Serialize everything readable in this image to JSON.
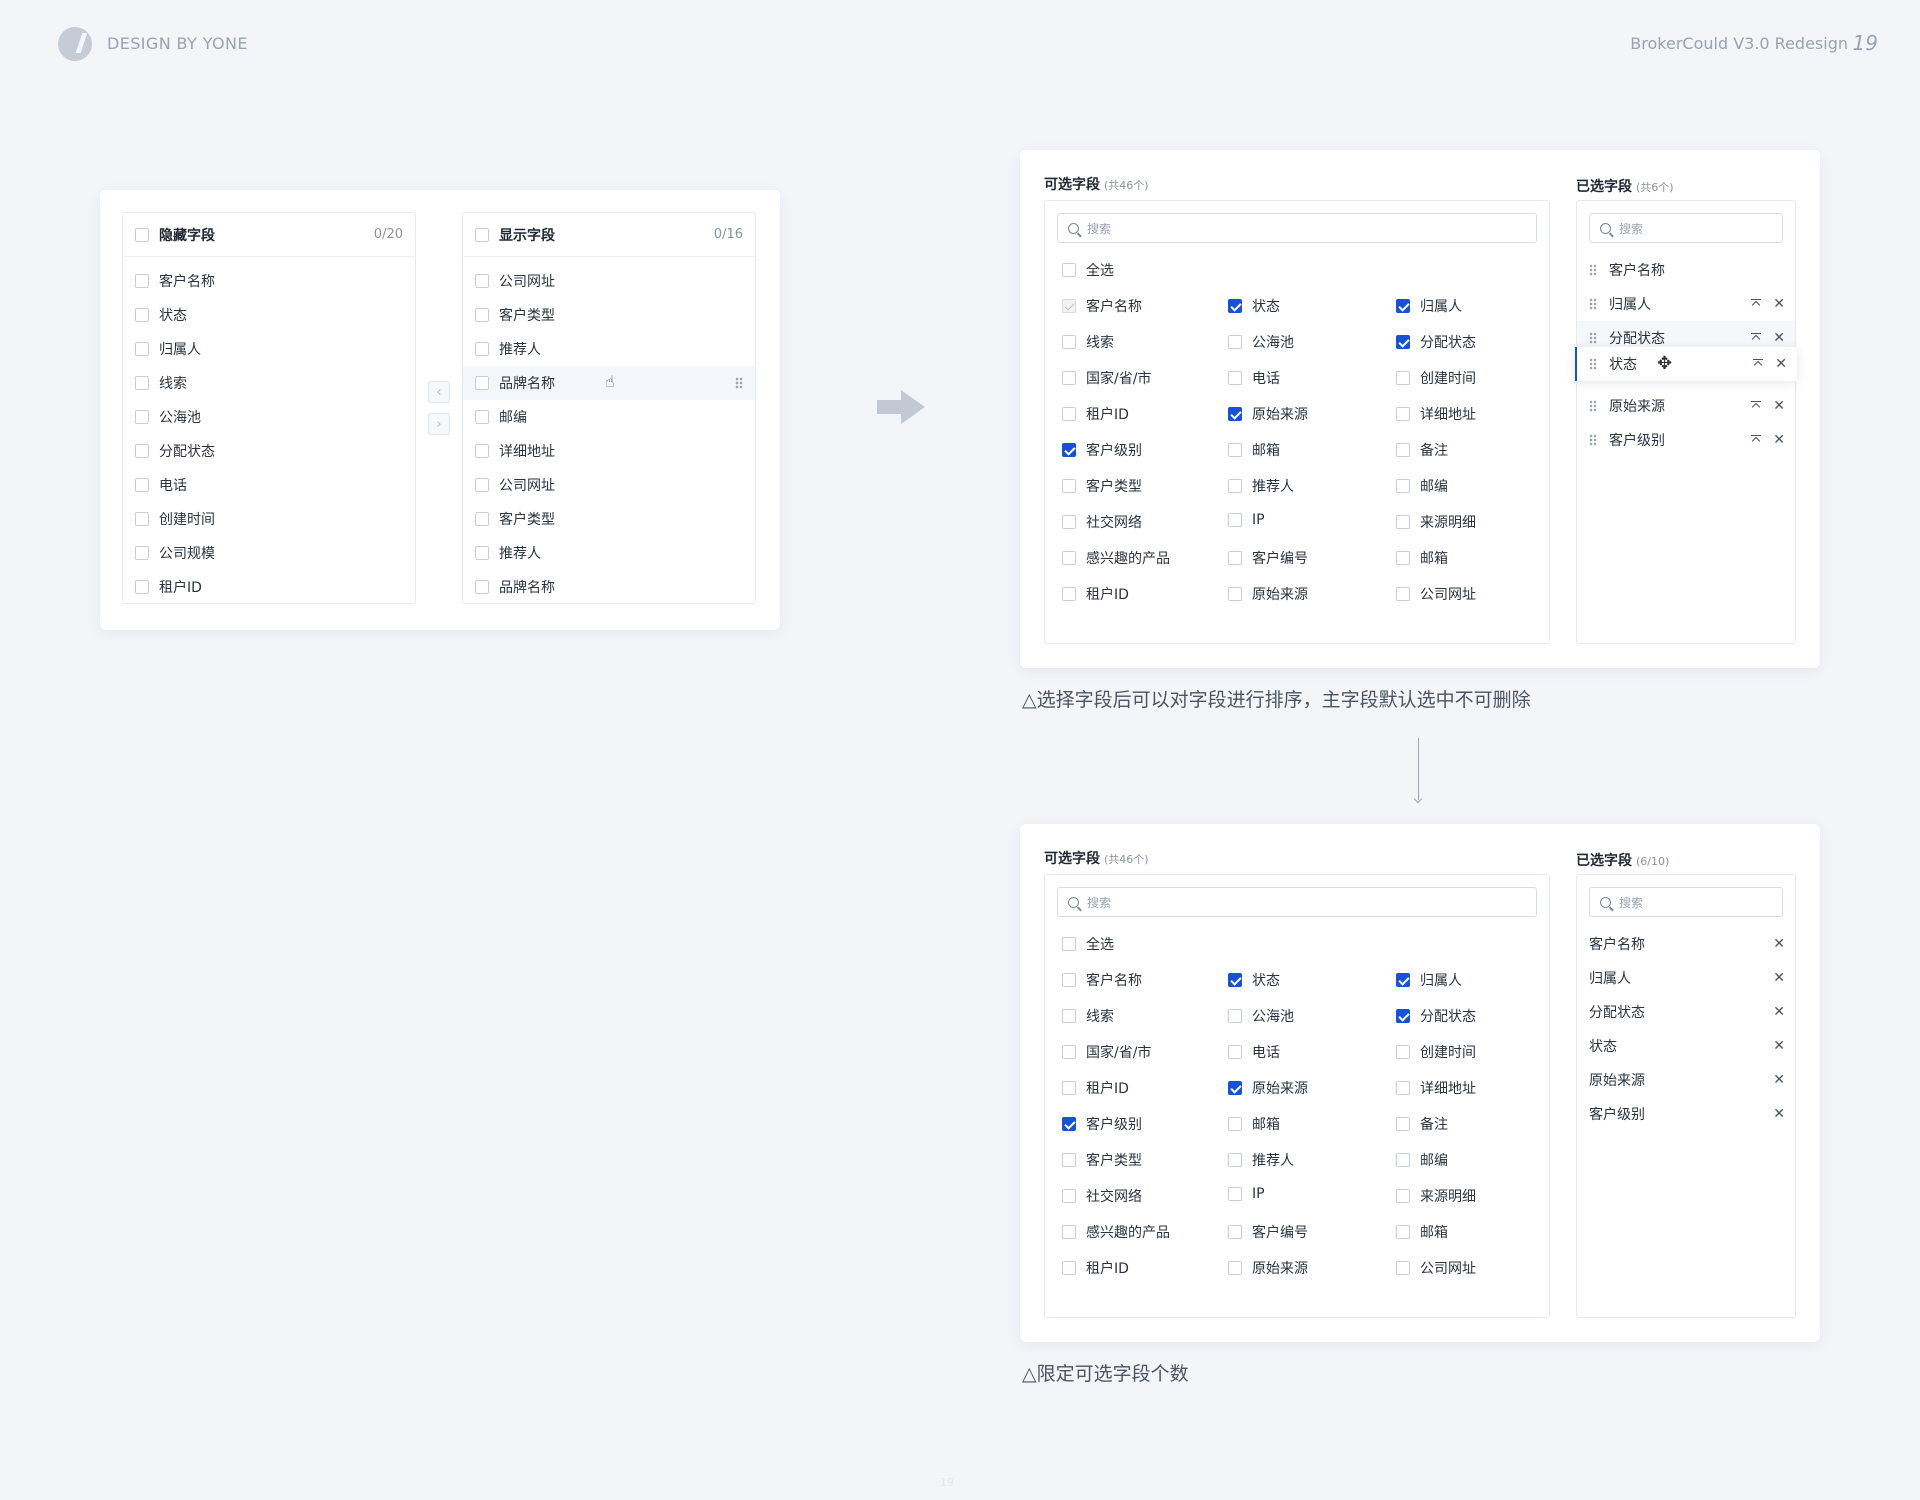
{
  "header": {
    "brand": "DESIGN BY YONE",
    "project": "BrokerCould V3.0 Redesign",
    "page_number": "19"
  },
  "transfer": {
    "left": {
      "title": "隐藏字段",
      "count": "0/20",
      "items": [
        "客户名称",
        "状态",
        "归属人",
        "线索",
        "公海池",
        "分配状态",
        "电话",
        "创建时间",
        "公司规模",
        "租户ID"
      ]
    },
    "right": {
      "title": "显示字段",
      "count": "0/16",
      "items": [
        "公司网址",
        "客户类型",
        "推荐人",
        "品牌名称",
        "邮编",
        "详细地址",
        "公司网址",
        "客户类型",
        "推荐人",
        "品牌名称"
      ],
      "hovered_index": 3
    },
    "move_left_icon": "chevron-left-icon",
    "move_right_icon": "chevron-right-icon"
  },
  "panel1": {
    "available_title": "可选字段",
    "available_sub": "(共46个)",
    "selected_title": "已选字段",
    "selected_sub": "(共6个)",
    "search_placeholder": "搜索",
    "select_all": "全选",
    "options": [
      {
        "label": "客户名称",
        "state": "disabled"
      },
      {
        "label": "状态",
        "state": "checked"
      },
      {
        "label": "归属人",
        "state": "checked"
      },
      {
        "label": "线索",
        "state": "unchecked"
      },
      {
        "label": "公海池",
        "state": "unchecked"
      },
      {
        "label": "分配状态",
        "state": "checked"
      },
      {
        "label": "国家/省/市",
        "state": "unchecked"
      },
      {
        "label": "电话",
        "state": "unchecked"
      },
      {
        "label": "创建时间",
        "state": "unchecked"
      },
      {
        "label": "租户ID",
        "state": "unchecked"
      },
      {
        "label": "原始来源",
        "state": "checked"
      },
      {
        "label": "详细地址",
        "state": "unchecked"
      },
      {
        "label": "客户级别",
        "state": "checked"
      },
      {
        "label": "邮箱",
        "state": "unchecked"
      },
      {
        "label": "备注",
        "state": "unchecked"
      },
      {
        "label": "客户类型",
        "state": "unchecked"
      },
      {
        "label": "推荐人",
        "state": "unchecked"
      },
      {
        "label": "邮编",
        "state": "unchecked"
      },
      {
        "label": "社交网络",
        "state": "unchecked"
      },
      {
        "label": "IP",
        "state": "unchecked"
      },
      {
        "label": "来源明细",
        "state": "unchecked"
      },
      {
        "label": "感兴趣的产品",
        "state": "unchecked"
      },
      {
        "label": "客户编号",
        "state": "unchecked"
      },
      {
        "label": "邮箱",
        "state": "unchecked"
      },
      {
        "label": "租户ID",
        "state": "unchecked"
      },
      {
        "label": "原始来源",
        "state": "unchecked"
      },
      {
        "label": "公司网址",
        "state": "unchecked"
      }
    ],
    "selected": [
      {
        "label": "客户名称",
        "actions": false
      },
      {
        "label": "归属人",
        "actions": true
      },
      {
        "label": "分配状态",
        "actions": true
      },
      {
        "label": "状态",
        "actions": true
      },
      {
        "label": "原始来源",
        "actions": true
      },
      {
        "label": "客户级别",
        "actions": true
      }
    ],
    "caption": "△选择字段后可以对字段进行排序，主字段默认选中不可删除"
  },
  "panel2": {
    "available_title": "可选字段",
    "available_sub": "(共46个)",
    "selected_title": "已选字段",
    "selected_sub": "(6/10)",
    "search_placeholder": "搜索",
    "select_all": "全选",
    "options": [
      {
        "label": "客户名称",
        "state": "unchecked"
      },
      {
        "label": "状态",
        "state": "checked"
      },
      {
        "label": "归属人",
        "state": "checked"
      },
      {
        "label": "线索",
        "state": "unchecked"
      },
      {
        "label": "公海池",
        "state": "unchecked"
      },
      {
        "label": "分配状态",
        "state": "checked"
      },
      {
        "label": "国家/省/市",
        "state": "unchecked"
      },
      {
        "label": "电话",
        "state": "unchecked"
      },
      {
        "label": "创建时间",
        "state": "unchecked"
      },
      {
        "label": "租户ID",
        "state": "unchecked"
      },
      {
        "label": "原始来源",
        "state": "checked"
      },
      {
        "label": "详细地址",
        "state": "unchecked"
      },
      {
        "label": "客户级别",
        "state": "checked"
      },
      {
        "label": "邮箱",
        "state": "unchecked"
      },
      {
        "label": "备注",
        "state": "unchecked"
      },
      {
        "label": "客户类型",
        "state": "unchecked"
      },
      {
        "label": "推荐人",
        "state": "unchecked"
      },
      {
        "label": "邮编",
        "state": "unchecked"
      },
      {
        "label": "社交网络",
        "state": "unchecked"
      },
      {
        "label": "IP",
        "state": "unchecked"
      },
      {
        "label": "来源明细",
        "state": "unchecked"
      },
      {
        "label": "感兴趣的产品",
        "state": "unchecked"
      },
      {
        "label": "客户编号",
        "state": "unchecked"
      },
      {
        "label": "邮箱",
        "state": "unchecked"
      },
      {
        "label": "租户ID",
        "state": "unchecked"
      },
      {
        "label": "原始来源",
        "state": "unchecked"
      },
      {
        "label": "公司网址",
        "state": "unchecked"
      }
    ],
    "selected": [
      "客户名称",
      "归属人",
      "分配状态",
      "状态",
      "原始来源",
      "客户级别"
    ],
    "caption": "△限定可选字段个数"
  },
  "colors": {
    "accent": "#1652d9",
    "background": "#f3f5f9"
  }
}
